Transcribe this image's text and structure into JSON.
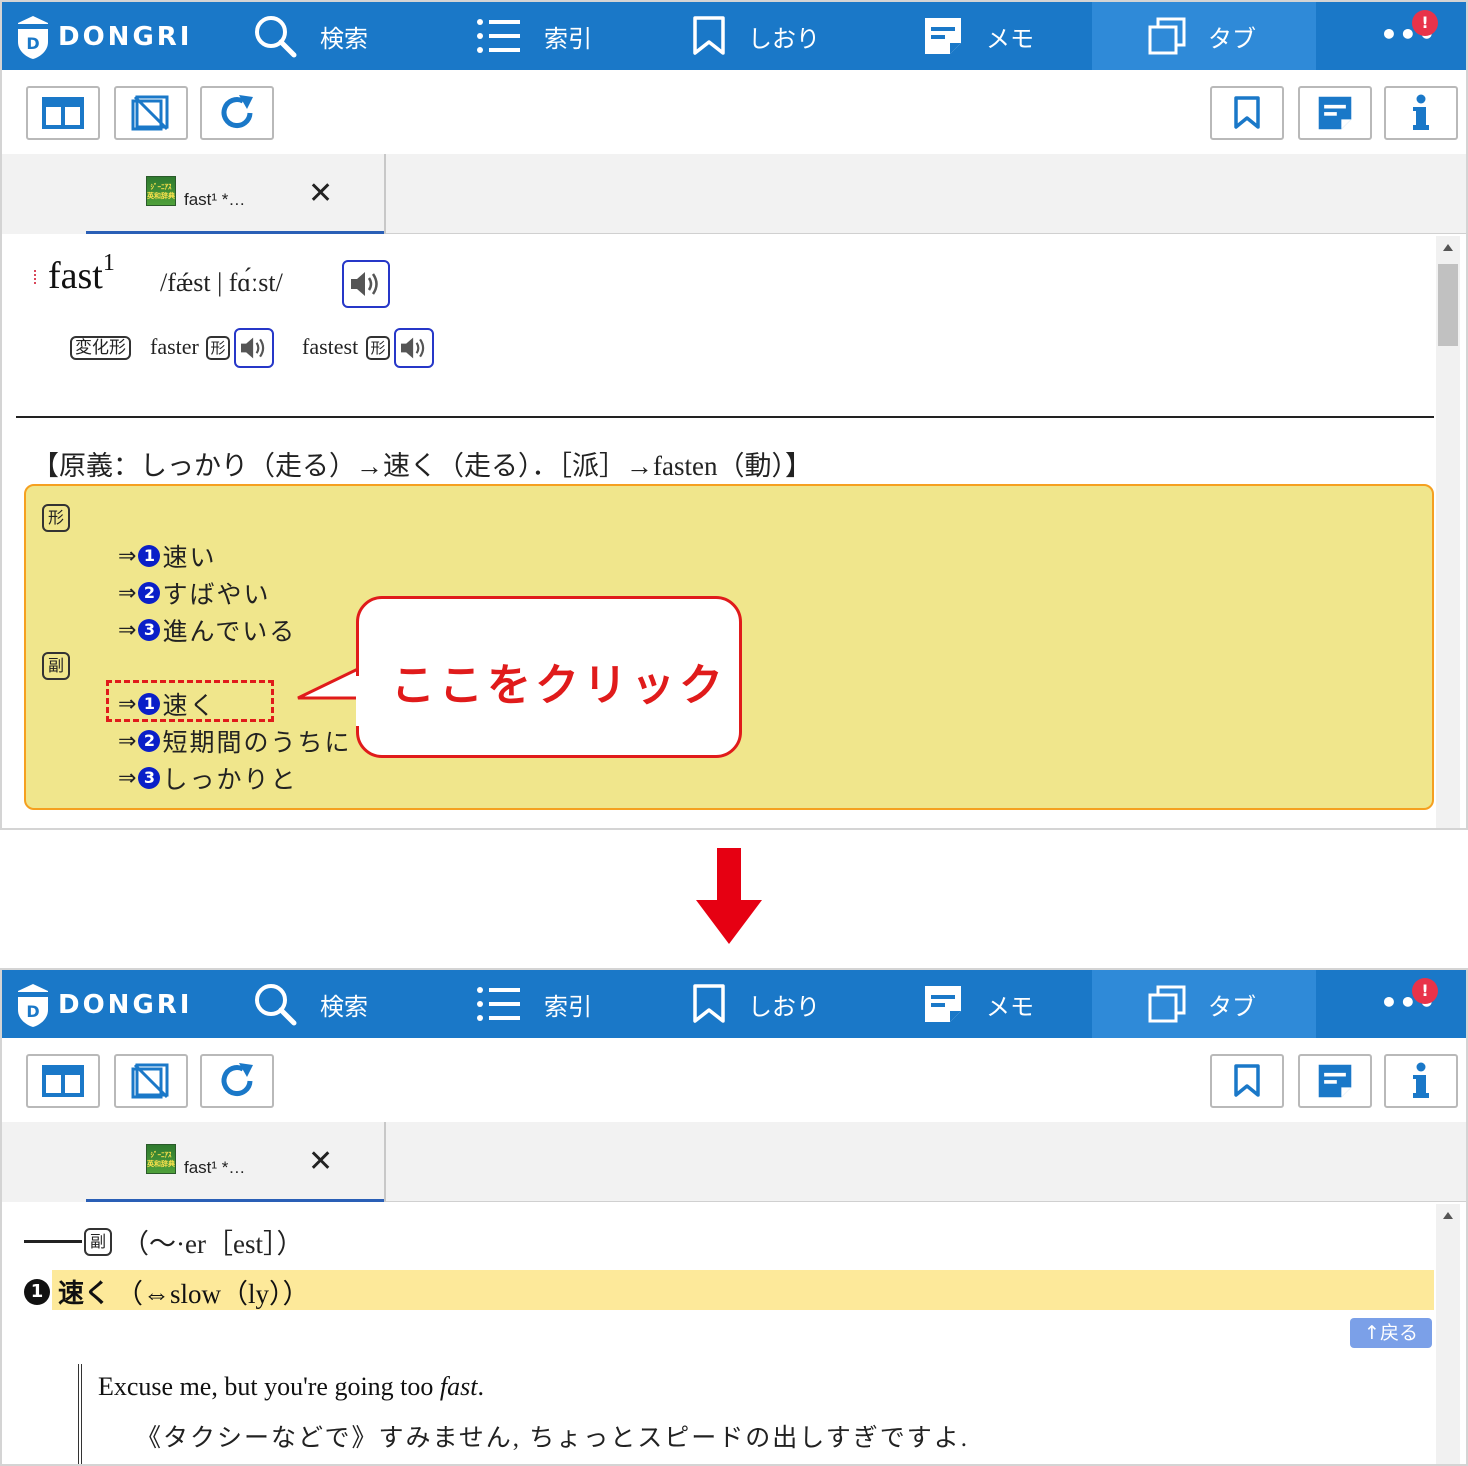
{
  "app": {
    "logo_text": "DONGRI",
    "nav": {
      "search": "検索",
      "index": "索引",
      "bookmark": "しおり",
      "memo": "メモ",
      "tab": "タブ",
      "more": "•••",
      "badge": "!"
    },
    "tab": {
      "label": "fast¹ *…",
      "close": "✕",
      "icon_text": "ジーニアス英和辞典"
    }
  },
  "before": {
    "headword": "fast",
    "headword_sup": "1",
    "pronunciation": "/fǽst | fɑ́ːst/",
    "inflection_tag": "変化形",
    "inflections": [
      {
        "word": "faster",
        "tag": "形"
      },
      {
        "word": "fastest",
        "tag": "形"
      }
    ],
    "etymology": "【原義：しっかり（走る）→速く（走る）．［派］→fasten（動）】",
    "adjective_tag": "形",
    "adjective_senses": [
      {
        "num": "1",
        "text": "速い"
      },
      {
        "num": "2",
        "text": "すばやい"
      },
      {
        "num": "3",
        "text": "進んでいる"
      }
    ],
    "adverb_tag": "副",
    "adverb_senses": [
      {
        "num": "1",
        "text": "速く"
      },
      {
        "num": "2",
        "text": "短期間のうちに"
      },
      {
        "num": "3",
        "text": "しっかりと"
      }
    ],
    "link_arrow": "⇒"
  },
  "callout": {
    "text": "ここをクリック",
    "color": "#e01b1b"
  },
  "after": {
    "pos_tag": "副",
    "pos_forms": "（～·er［est］）",
    "sense_num": "1",
    "sense_main": "速く",
    "sense_note": "（⇔slow（ly））",
    "back_button": "↑戻る",
    "example_en_prefix": "Excuse me, but you're going too ",
    "example_en_italic": "fast",
    "example_en_suffix": ".",
    "example_ja": "《タクシーなどで》すみません, ちょっとスピードの出しすぎですよ."
  },
  "colors": {
    "header": "#1a78c8",
    "accent_blue": "#1a78c8",
    "sense_box": "#f0e68c",
    "sense_box_border": "#f5a020",
    "highlight_bar": "#fde99a",
    "red": "#e01b1b"
  }
}
